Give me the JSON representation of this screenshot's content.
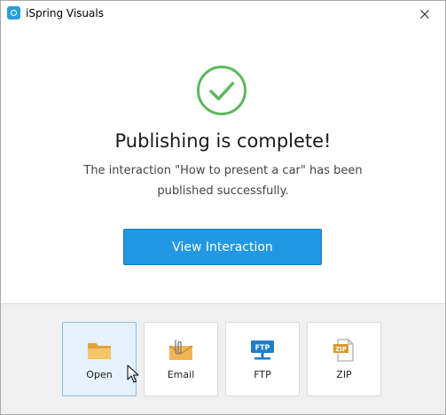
{
  "window": {
    "title": "iSpring Visuals",
    "app_icon": "ispring-app-icon",
    "close_icon": "close-icon"
  },
  "main": {
    "status_icon": "check-circle-icon",
    "headline": "Publishing is complete!",
    "message": "The interaction \"How to present a car\" has been published successfully.",
    "primary_button": "View Interaction"
  },
  "actions": [
    {
      "label": "Open",
      "icon": "folder-icon",
      "selected": true
    },
    {
      "label": "Email",
      "icon": "email-icon",
      "selected": false
    },
    {
      "label": "FTP",
      "icon": "ftp-icon",
      "selected": false
    },
    {
      "label": "ZIP",
      "icon": "zip-icon",
      "selected": false
    }
  ],
  "icon_text": {
    "ftp": "FTP",
    "zip": "ZIP"
  },
  "colors": {
    "accent": "#2298e4",
    "success": "#5cb85c",
    "selected_tile": "#e5f1fb",
    "footer_bg": "#f0f0f0"
  }
}
